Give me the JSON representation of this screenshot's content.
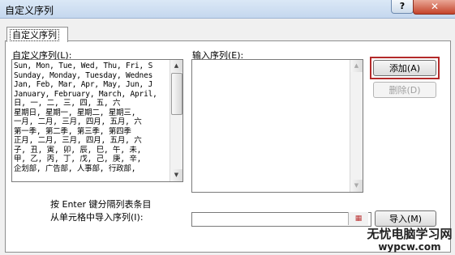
{
  "window": {
    "title": "自定义序列",
    "help_label": "?",
    "close_label": "✕"
  },
  "tabs": [
    {
      "label": "自定义序列"
    }
  ],
  "custom_lists": {
    "label": "自定义序列(L):",
    "items": [
      "Sun, Mon, Tue, Wed, Thu, Fri, S",
      "Sunday, Monday, Tuesday, Wednes",
      "Jan, Feb, Mar, Apr, May, Jun, J",
      "January, February, March, April,",
      "日, 一, 二, 三, 四, 五, 六",
      "星期日, 星期一, 星期二, 星期三,",
      "一月, 二月, 三月, 四月, 五月, 六",
      "第一季, 第二季, 第三季, 第四季",
      "正月, 二月, 三月, 四月, 五月, 六",
      "子, 丑, 寅, 卯, 辰, 巳, 午, 未,",
      "甲, 乙, 丙, 丁, 戊, 己, 庚, 辛,",
      "企划部, 广告部, 人事部, 行政部,"
    ]
  },
  "entries": {
    "label": "输入序列(E):",
    "value": ""
  },
  "buttons": {
    "add": "添加(A)",
    "delete": "删除(D)",
    "import": "导入(M)"
  },
  "hints": {
    "separator_hint": "按 Enter 键分隔列表条目",
    "import_label": "从单元格中导入序列(I):"
  },
  "import_field": {
    "value": ""
  },
  "watermark": {
    "line1": "无忧电脑学习网",
    "line2": "wypcw.com"
  },
  "colors": {
    "highlight": "#b32a2a",
    "close_button": "#c4432a"
  }
}
